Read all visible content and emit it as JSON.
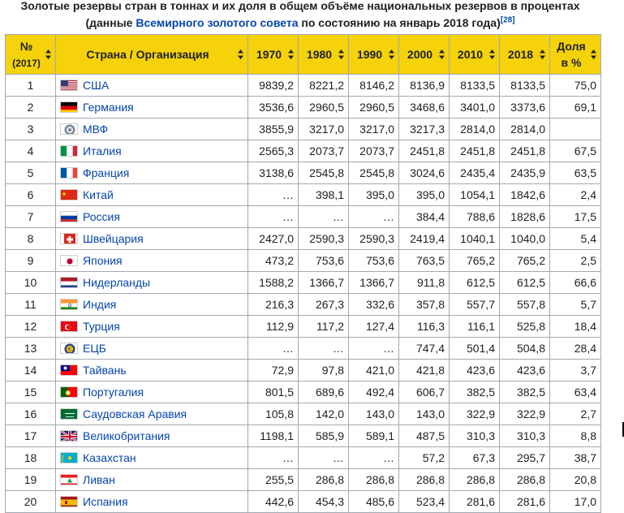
{
  "caption": {
    "line1": "Золотые резервы стран в тоннах и их доля в общем объёме национальных резервов в процентах",
    "line2_prefix": "(данные ",
    "line2_link": "Всемирного золотого совета",
    "line2_suffix": " по состоянию на январь 2018 года)",
    "ref": "[28]"
  },
  "headers": {
    "rank_top": "№",
    "rank_sub": "(2017)",
    "country": "Страна / Организация",
    "y1970": "1970",
    "y1980": "1980",
    "y1990": "1990",
    "y2000": "2000",
    "y2010": "2010",
    "y2018": "2018",
    "share_top": "Доля",
    "share_sub": "в %"
  },
  "rows": [
    {
      "rank": "1",
      "country": "США",
      "flag": "us-flag",
      "v1970": "9839,2",
      "v1980": "8221,2",
      "v1990": "8146,2",
      "v2000": "8136,9",
      "v2010": "8133,5",
      "v2018": "8133,5",
      "share": "75,0"
    },
    {
      "rank": "2",
      "country": "Германия",
      "flag": "de-flag",
      "v1970": "3536,6",
      "v1980": "2960,5",
      "v1990": "2960,5",
      "v2000": "3468,6",
      "v2010": "3401,0",
      "v2018": "3373,6",
      "share": "69,1"
    },
    {
      "rank": "3",
      "country": "МВФ",
      "flag": "imf-logo",
      "v1970": "3855,9",
      "v1980": "3217,0",
      "v1990": "3217,0",
      "v2000": "3217,3",
      "v2010": "2814,0",
      "v2018": "2814,0",
      "share": ""
    },
    {
      "rank": "4",
      "country": "Италия",
      "flag": "it-flag",
      "v1970": "2565,3",
      "v1980": "2073,7",
      "v1990": "2073,7",
      "v2000": "2451,8",
      "v2010": "2451,8",
      "v2018": "2451,8",
      "share": "67,5"
    },
    {
      "rank": "5",
      "country": "Франция",
      "flag": "fr-flag",
      "v1970": "3138,6",
      "v1980": "2545,8",
      "v1990": "2545,8",
      "v2000": "3024,6",
      "v2010": "2435,4",
      "v2018": "2435,9",
      "share": "63,5"
    },
    {
      "rank": "6",
      "country": "Китай",
      "flag": "cn-flag",
      "v1970": "…",
      "v1980": "398,1",
      "v1990": "395,0",
      "v2000": "395,0",
      "v2010": "1054,1",
      "v2018": "1842,6",
      "share": "2,4"
    },
    {
      "rank": "7",
      "country": "Россия",
      "flag": "ru-flag",
      "v1970": "…",
      "v1980": "…",
      "v1990": "…",
      "v2000": "384,4",
      "v2010": "788,6",
      "v2018": "1828,6",
      "share": "17,5"
    },
    {
      "rank": "8",
      "country": "Швейцария",
      "flag": "ch-flag",
      "v1970": "2427,0",
      "v1980": "2590,3",
      "v1990": "2590,3",
      "v2000": "2419,4",
      "v2010": "1040,1",
      "v2018": "1040,0",
      "share": "5,4"
    },
    {
      "rank": "9",
      "country": "Япония",
      "flag": "jp-flag",
      "v1970": "473,2",
      "v1980": "753,6",
      "v1990": "753,6",
      "v2000": "763,5",
      "v2010": "765,2",
      "v2018": "765,2",
      "share": "2,5"
    },
    {
      "rank": "10",
      "country": "Нидерланды",
      "flag": "nl-flag",
      "v1970": "1588,2",
      "v1980": "1366,7",
      "v1990": "1366,7",
      "v2000": "911,8",
      "v2010": "612,5",
      "v2018": "612,5",
      "share": "66,6"
    },
    {
      "rank": "11",
      "country": "Индия",
      "flag": "in-flag",
      "v1970": "216,3",
      "v1980": "267,3",
      "v1990": "332,6",
      "v2000": "357,8",
      "v2010": "557,7",
      "v2018": "557,8",
      "share": "5,7"
    },
    {
      "rank": "12",
      "country": "Турция",
      "flag": "tr-flag",
      "v1970": "112,9",
      "v1980": "117,2",
      "v1990": "127,4",
      "v2000": "116,3",
      "v2010": "116,1",
      "v2018": "525,8",
      "share": "18,4"
    },
    {
      "rank": "13",
      "country": "ЕЦБ",
      "flag": "ecb-logo",
      "v1970": "…",
      "v1980": "…",
      "v1990": "…",
      "v2000": "747,4",
      "v2010": "501,4",
      "v2018": "504,8",
      "share": "28,4"
    },
    {
      "rank": "14",
      "country": "Тайвань",
      "flag": "tw-flag",
      "v1970": "72,9",
      "v1980": "97,8",
      "v1990": "421,0",
      "v2000": "421,8",
      "v2010": "423,6",
      "v2018": "423,6",
      "share": "3,7"
    },
    {
      "rank": "15",
      "country": "Португалия",
      "flag": "pt-flag",
      "v1970": "801,5",
      "v1980": "689,6",
      "v1990": "492,4",
      "v2000": "606,7",
      "v2010": "382,5",
      "v2018": "382,5",
      "share": "63,4"
    },
    {
      "rank": "16",
      "country": "Саудовская Аравия",
      "flag": "sa-flag",
      "v1970": "105,8",
      "v1980": "142,0",
      "v1990": "143,0",
      "v2000": "143,0",
      "v2010": "322,9",
      "v2018": "322,9",
      "share": "2,7"
    },
    {
      "rank": "17",
      "country": "Великобритания",
      "flag": "gb-flag",
      "v1970": "1198,1",
      "v1980": "585,9",
      "v1990": "589,1",
      "v2000": "487,5",
      "v2010": "310,3",
      "v2018": "310,3",
      "share": "8,8"
    },
    {
      "rank": "18",
      "country": "Казахстан",
      "flag": "kz-flag",
      "v1970": "…",
      "v1980": "…",
      "v1990": "…",
      "v2000": "57,2",
      "v2010": "67,3",
      "v2018": "295,7",
      "share": "38,7"
    },
    {
      "rank": "19",
      "country": "Ливан",
      "flag": "lb-flag",
      "v1970": "255,5",
      "v1980": "286,8",
      "v1990": "286,8",
      "v2000": "286,8",
      "v2010": "286,8",
      "v2018": "286,8",
      "share": "20,8"
    },
    {
      "rank": "20",
      "country": "Испания",
      "flag": "es-flag",
      "v1970": "442,6",
      "v1980": "454,3",
      "v1990": "485,6",
      "v2000": "523,4",
      "v2010": "281,6",
      "v2018": "281,6",
      "share": "17,0"
    }
  ]
}
